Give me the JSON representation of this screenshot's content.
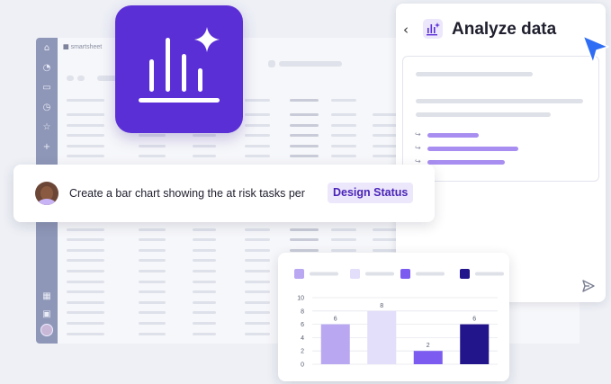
{
  "app": {
    "brand": "smartsheet"
  },
  "panel": {
    "title": "Analyze data",
    "back_icon": "chevron-left-icon",
    "title_icon": "chart-sparkle-icon"
  },
  "prompt": {
    "text": "Create a bar chart showing the at risk tasks per",
    "chip": "Design Status"
  },
  "colors": {
    "brand_purple": "#5b2fd6",
    "cursor_blue": "#2f6df5",
    "bar_1": "#b9a7f2",
    "bar_2": "#e3defa",
    "bar_3": "#7c5cf0",
    "bar_4": "#22148a"
  },
  "chart_data": {
    "type": "bar",
    "categories": [
      "",
      "",
      "",
      ""
    ],
    "values": [
      6,
      8,
      2,
      6
    ],
    "data_labels": [
      "6",
      "8",
      "2",
      "6"
    ],
    "yticks": [
      "0",
      "2",
      "4",
      "6",
      "8",
      "10"
    ],
    "ylim": [
      0,
      10
    ],
    "grid": true,
    "legend": "top",
    "colors": [
      "#b9a7f2",
      "#e3defa",
      "#7c5cf0",
      "#22148a"
    ]
  }
}
